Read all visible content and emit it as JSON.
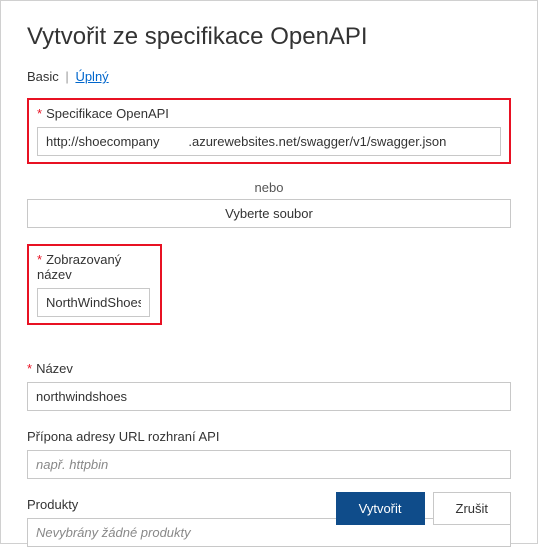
{
  "title": "Vytvořit ze specifikace OpenAPI",
  "tabs": {
    "basic": "Basic",
    "separator": "|",
    "full": "Úplný"
  },
  "fields": {
    "spec": {
      "label": "Specifikace OpenAPI",
      "value": "http://shoecompany        .azurewebsites.net/swagger/v1/swagger.json"
    },
    "or": "nebo",
    "selectFile": "Vyberte soubor",
    "displayName": {
      "label": "Zobrazovaný název",
      "value": "NorthWindShoes"
    },
    "name": {
      "label": "Název",
      "value": "northwindshoes"
    },
    "urlSuffix": {
      "label": "Přípona adresy URL rozhraní API",
      "placeholder": "např. httpbin"
    },
    "products": {
      "label": "Produkty",
      "placeholder": "Nevybrány žádné produkty"
    }
  },
  "buttons": {
    "create": "Vytvořit",
    "cancel": "Zrušit"
  },
  "requiredMark": "*"
}
